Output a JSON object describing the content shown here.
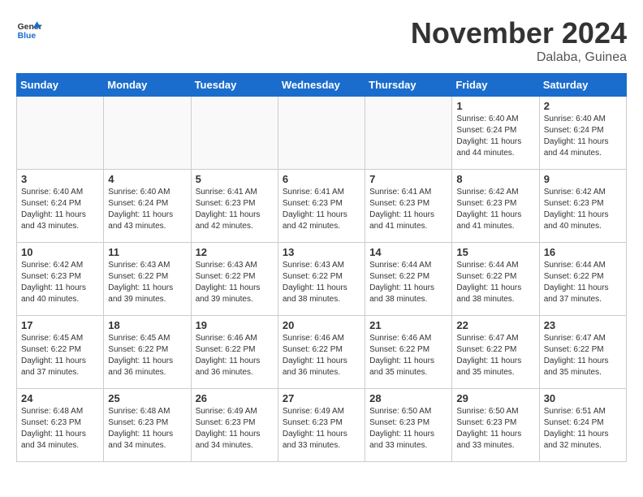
{
  "header": {
    "logo_line1": "General",
    "logo_line2": "Blue",
    "month": "November 2024",
    "location": "Dalaba, Guinea"
  },
  "weekdays": [
    "Sunday",
    "Monday",
    "Tuesday",
    "Wednesday",
    "Thursday",
    "Friday",
    "Saturday"
  ],
  "weeks": [
    [
      {
        "day": "",
        "info": ""
      },
      {
        "day": "",
        "info": ""
      },
      {
        "day": "",
        "info": ""
      },
      {
        "day": "",
        "info": ""
      },
      {
        "day": "",
        "info": ""
      },
      {
        "day": "1",
        "info": "Sunrise: 6:40 AM\nSunset: 6:24 PM\nDaylight: 11 hours and 44 minutes."
      },
      {
        "day": "2",
        "info": "Sunrise: 6:40 AM\nSunset: 6:24 PM\nDaylight: 11 hours and 44 minutes."
      }
    ],
    [
      {
        "day": "3",
        "info": "Sunrise: 6:40 AM\nSunset: 6:24 PM\nDaylight: 11 hours and 43 minutes."
      },
      {
        "day": "4",
        "info": "Sunrise: 6:40 AM\nSunset: 6:24 PM\nDaylight: 11 hours and 43 minutes."
      },
      {
        "day": "5",
        "info": "Sunrise: 6:41 AM\nSunset: 6:23 PM\nDaylight: 11 hours and 42 minutes."
      },
      {
        "day": "6",
        "info": "Sunrise: 6:41 AM\nSunset: 6:23 PM\nDaylight: 11 hours and 42 minutes."
      },
      {
        "day": "7",
        "info": "Sunrise: 6:41 AM\nSunset: 6:23 PM\nDaylight: 11 hours and 41 minutes."
      },
      {
        "day": "8",
        "info": "Sunrise: 6:42 AM\nSunset: 6:23 PM\nDaylight: 11 hours and 41 minutes."
      },
      {
        "day": "9",
        "info": "Sunrise: 6:42 AM\nSunset: 6:23 PM\nDaylight: 11 hours and 40 minutes."
      }
    ],
    [
      {
        "day": "10",
        "info": "Sunrise: 6:42 AM\nSunset: 6:23 PM\nDaylight: 11 hours and 40 minutes."
      },
      {
        "day": "11",
        "info": "Sunrise: 6:43 AM\nSunset: 6:22 PM\nDaylight: 11 hours and 39 minutes."
      },
      {
        "day": "12",
        "info": "Sunrise: 6:43 AM\nSunset: 6:22 PM\nDaylight: 11 hours and 39 minutes."
      },
      {
        "day": "13",
        "info": "Sunrise: 6:43 AM\nSunset: 6:22 PM\nDaylight: 11 hours and 38 minutes."
      },
      {
        "day": "14",
        "info": "Sunrise: 6:44 AM\nSunset: 6:22 PM\nDaylight: 11 hours and 38 minutes."
      },
      {
        "day": "15",
        "info": "Sunrise: 6:44 AM\nSunset: 6:22 PM\nDaylight: 11 hours and 38 minutes."
      },
      {
        "day": "16",
        "info": "Sunrise: 6:44 AM\nSunset: 6:22 PM\nDaylight: 11 hours and 37 minutes."
      }
    ],
    [
      {
        "day": "17",
        "info": "Sunrise: 6:45 AM\nSunset: 6:22 PM\nDaylight: 11 hours and 37 minutes."
      },
      {
        "day": "18",
        "info": "Sunrise: 6:45 AM\nSunset: 6:22 PM\nDaylight: 11 hours and 36 minutes."
      },
      {
        "day": "19",
        "info": "Sunrise: 6:46 AM\nSunset: 6:22 PM\nDaylight: 11 hours and 36 minutes."
      },
      {
        "day": "20",
        "info": "Sunrise: 6:46 AM\nSunset: 6:22 PM\nDaylight: 11 hours and 36 minutes."
      },
      {
        "day": "21",
        "info": "Sunrise: 6:46 AM\nSunset: 6:22 PM\nDaylight: 11 hours and 35 minutes."
      },
      {
        "day": "22",
        "info": "Sunrise: 6:47 AM\nSunset: 6:22 PM\nDaylight: 11 hours and 35 minutes."
      },
      {
        "day": "23",
        "info": "Sunrise: 6:47 AM\nSunset: 6:22 PM\nDaylight: 11 hours and 35 minutes."
      }
    ],
    [
      {
        "day": "24",
        "info": "Sunrise: 6:48 AM\nSunset: 6:23 PM\nDaylight: 11 hours and 34 minutes."
      },
      {
        "day": "25",
        "info": "Sunrise: 6:48 AM\nSunset: 6:23 PM\nDaylight: 11 hours and 34 minutes."
      },
      {
        "day": "26",
        "info": "Sunrise: 6:49 AM\nSunset: 6:23 PM\nDaylight: 11 hours and 34 minutes."
      },
      {
        "day": "27",
        "info": "Sunrise: 6:49 AM\nSunset: 6:23 PM\nDaylight: 11 hours and 33 minutes."
      },
      {
        "day": "28",
        "info": "Sunrise: 6:50 AM\nSunset: 6:23 PM\nDaylight: 11 hours and 33 minutes."
      },
      {
        "day": "29",
        "info": "Sunrise: 6:50 AM\nSunset: 6:23 PM\nDaylight: 11 hours and 33 minutes."
      },
      {
        "day": "30",
        "info": "Sunrise: 6:51 AM\nSunset: 6:24 PM\nDaylight: 11 hours and 32 minutes."
      }
    ]
  ]
}
